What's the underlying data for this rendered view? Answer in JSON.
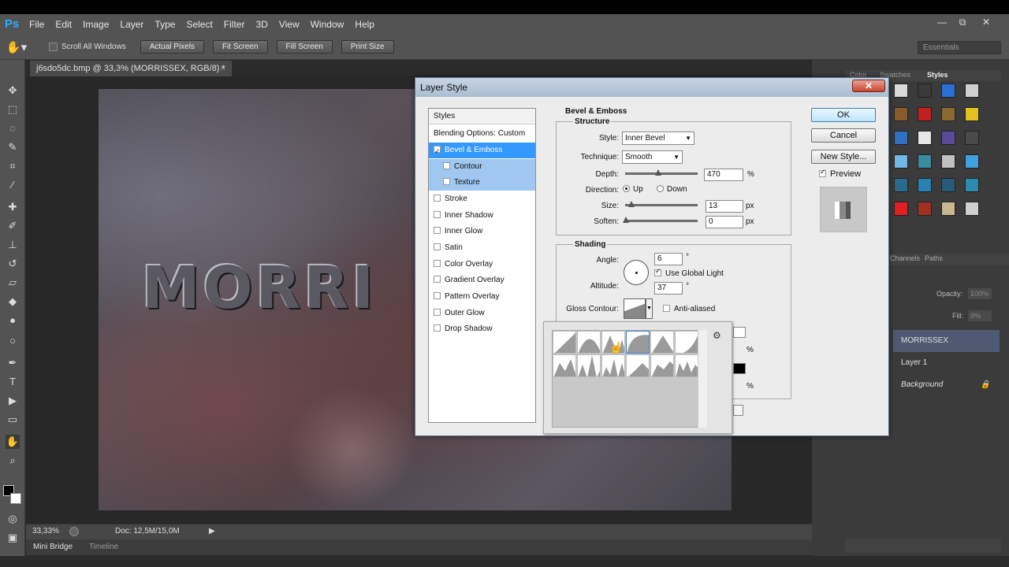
{
  "app": {
    "logo": "Ps",
    "menu": [
      "File",
      "Edit",
      "Image",
      "Layer",
      "Type",
      "Select",
      "Filter",
      "3D",
      "View",
      "Window",
      "Help"
    ],
    "window_controls": [
      "—",
      "⧉",
      "✕"
    ],
    "workspace": "Essentials"
  },
  "options_bar": {
    "scroll_all_label": "Scroll All Windows",
    "buttons": [
      "Actual Pixels",
      "Fit Screen",
      "Fill Screen",
      "Print Size"
    ]
  },
  "document": {
    "tab_title": "j6sdo5dc.bmp @ 33,3% (MORRISSEX, RGB/8) *",
    "tab_close": "×",
    "canvas_text": "MORRI",
    "zoom": "33,33%",
    "doc_size": "Doc: 12,5M/15,0M"
  },
  "bottom_tabs": [
    "Mini Bridge",
    "Timeline"
  ],
  "panels": {
    "top_tabs": [
      "Color",
      "Swatches",
      "Styles"
    ],
    "layer_tabs": [
      "Channels",
      "Paths"
    ],
    "opacity_label": "Opacity:",
    "opacity_value": "100%",
    "fill_label": "Fill:",
    "fill_value": "0%",
    "layers": [
      {
        "name": "MORRISSEX",
        "selected": true
      },
      {
        "name": "Layer 1",
        "selected": false
      },
      {
        "name": "Background",
        "selected": false,
        "locked": true
      }
    ],
    "swatch_colors": [
      "#d8d8d8",
      "#3a3a3a",
      "#2a6fd6",
      "#cfcfcf",
      "#8a5a2a",
      "#c02020",
      "#8a6a30",
      "#e6c020",
      "#3070c0",
      "#e8e8e8",
      "#5a4a9a",
      "#4a4a4a",
      "#70b8e8",
      "#3a8aa0",
      "#c0c0c0",
      "#40a0e0",
      "#2a6a8a",
      "#2a80b0",
      "#2a5a7a",
      "#2a8ab0",
      "#e02020",
      "#a03020",
      "#c8b890",
      "#d0d0d0"
    ]
  },
  "dialog": {
    "title": "Layer Style",
    "close": "✕",
    "styles_header": "Styles",
    "blending": "Blending Options: Custom",
    "styles": [
      {
        "label": "Bevel & Emboss",
        "checked": true,
        "selected": true
      },
      {
        "label": "Contour",
        "checked": false,
        "sub": true
      },
      {
        "label": "Texture",
        "checked": false,
        "sub": true
      },
      {
        "label": "Stroke",
        "checked": false
      },
      {
        "label": "Inner Shadow",
        "checked": false
      },
      {
        "label": "Inner Glow",
        "checked": false
      },
      {
        "label": "Satin",
        "checked": false
      },
      {
        "label": "Color Overlay",
        "checked": false
      },
      {
        "label": "Gradient Overlay",
        "checked": false
      },
      {
        "label": "Pattern Overlay",
        "checked": false
      },
      {
        "label": "Outer Glow",
        "checked": false
      },
      {
        "label": "Drop Shadow",
        "checked": false
      }
    ],
    "section_title": "Bevel & Emboss",
    "structure": {
      "title": "Structure",
      "style_label": "Style:",
      "style_value": "Inner Bevel",
      "technique_label": "Technique:",
      "technique_value": "Smooth",
      "depth_label": "Depth:",
      "depth_value": "470",
      "depth_unit": "%",
      "depth_level": 0.47,
      "direction_label": "Direction:",
      "dir_up": "Up",
      "dir_down": "Down",
      "size_label": "Size:",
      "size_value": "13",
      "size_unit": "px",
      "size_level": 0.08,
      "soften_label": "Soften:",
      "soften_value": "0",
      "soften_unit": "px",
      "soften_level": 0.0
    },
    "shading": {
      "title": "Shading",
      "angle_label": "Angle:",
      "angle_value": "6",
      "angle_unit": "°",
      "global_light_label": "Use Global Light",
      "altitude_label": "Altitude:",
      "altitude_value": "37",
      "altitude_unit": "°",
      "gloss_label": "Gloss Contour:",
      "anti_aliased_label": "Anti-aliased",
      "percent_unit": "%"
    },
    "buttons": {
      "ok": "OK",
      "cancel": "Cancel",
      "new_style": "New Style..."
    },
    "preview_label": "Preview"
  }
}
